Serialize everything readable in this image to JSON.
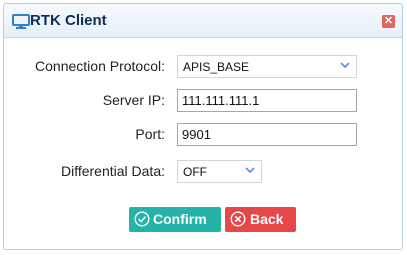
{
  "window": {
    "title": "RTK Client"
  },
  "form": {
    "protocol_label": "Connection Protocol:",
    "protocol_value": "APIS_BASE",
    "server_ip_label": "Server IP:",
    "server_ip_value": "111.111.111.1",
    "port_label": "Port:",
    "port_value": "9901",
    "diff_label": "Differential Data:",
    "diff_value": "OFF"
  },
  "buttons": {
    "confirm": "Confirm",
    "back": "Back"
  },
  "colors": {
    "accent_confirm": "#25b3a9",
    "accent_back": "#e6484a",
    "title": "#0f2c52",
    "chevron": "#5b8fd6"
  },
  "icons": {
    "title": "monitor-icon",
    "close": "close-icon",
    "confirm": "check-circle-icon",
    "back": "x-circle-icon"
  }
}
